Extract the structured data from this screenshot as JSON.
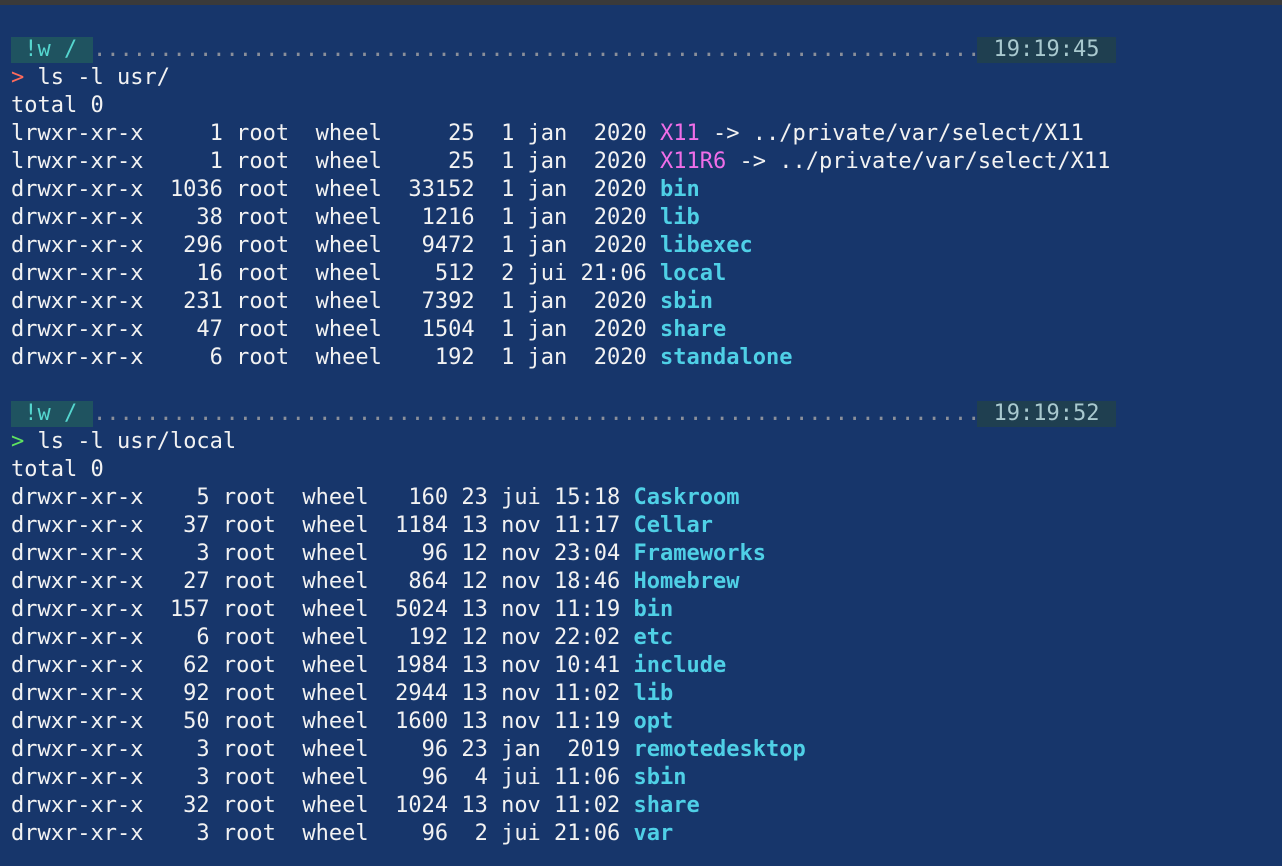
{
  "blocks": [
    {
      "path_segment": " !w / ",
      "dots": ".............................................................................................................",
      "time": "19:19:45",
      "prompt_symbol": ">",
      "command": " ls -l usr/",
      "total": "total 0",
      "rows": [
        {
          "meta": "lrwxr-xr-x     1 root  wheel     25  1 jan  2020 ",
          "name": "X11",
          "kind": "link",
          "target": " -> ../private/var/select/X11"
        },
        {
          "meta": "lrwxr-xr-x     1 root  wheel     25  1 jan  2020 ",
          "name": "X11R6",
          "kind": "link",
          "target": " -> ../private/var/select/X11"
        },
        {
          "meta": "drwxr-xr-x  1036 root  wheel  33152  1 jan  2020 ",
          "name": "bin",
          "kind": "dir",
          "target": ""
        },
        {
          "meta": "drwxr-xr-x    38 root  wheel   1216  1 jan  2020 ",
          "name": "lib",
          "kind": "dir",
          "target": ""
        },
        {
          "meta": "drwxr-xr-x   296 root  wheel   9472  1 jan  2020 ",
          "name": "libexec",
          "kind": "dir",
          "target": ""
        },
        {
          "meta": "drwxr-xr-x    16 root  wheel    512  2 jui 21:06 ",
          "name": "local",
          "kind": "dir",
          "target": ""
        },
        {
          "meta": "drwxr-xr-x   231 root  wheel   7392  1 jan  2020 ",
          "name": "sbin",
          "kind": "dir",
          "target": ""
        },
        {
          "meta": "drwxr-xr-x    47 root  wheel   1504  1 jan  2020 ",
          "name": "share",
          "kind": "dir",
          "target": ""
        },
        {
          "meta": "drwxr-xr-x     6 root  wheel    192  1 jan  2020 ",
          "name": "standalone",
          "kind": "dir",
          "target": ""
        }
      ]
    },
    {
      "path_segment": " !w / ",
      "dots": ".............................................................................................................",
      "time": "19:19:52",
      "prompt_symbol": ">",
      "command": " ls -l usr/local",
      "total": "total 0",
      "rows": [
        {
          "meta": "drwxr-xr-x    5 root  wheel   160 23 jui 15:18 ",
          "name": "Caskroom",
          "kind": "dir",
          "target": ""
        },
        {
          "meta": "drwxr-xr-x   37 root  wheel  1184 13 nov 11:17 ",
          "name": "Cellar",
          "kind": "dir",
          "target": ""
        },
        {
          "meta": "drwxr-xr-x    3 root  wheel    96 12 nov 23:04 ",
          "name": "Frameworks",
          "kind": "dir",
          "target": ""
        },
        {
          "meta": "drwxr-xr-x   27 root  wheel   864 12 nov 18:46 ",
          "name": "Homebrew",
          "kind": "dir",
          "target": ""
        },
        {
          "meta": "drwxr-xr-x  157 root  wheel  5024 13 nov 11:19 ",
          "name": "bin",
          "kind": "dir",
          "target": ""
        },
        {
          "meta": "drwxr-xr-x    6 root  wheel   192 12 nov 22:02 ",
          "name": "etc",
          "kind": "dir",
          "target": ""
        },
        {
          "meta": "drwxr-xr-x   62 root  wheel  1984 13 nov 10:41 ",
          "name": "include",
          "kind": "dir",
          "target": ""
        },
        {
          "meta": "drwxr-xr-x   92 root  wheel  2944 13 nov 11:02 ",
          "name": "lib",
          "kind": "dir",
          "target": ""
        },
        {
          "meta": "drwxr-xr-x   50 root  wheel  1600 13 nov 11:19 ",
          "name": "opt",
          "kind": "dir",
          "target": ""
        },
        {
          "meta": "drwxr-xr-x    3 root  wheel    96 23 jan  2019 ",
          "name": "remotedesktop",
          "kind": "dir",
          "target": ""
        },
        {
          "meta": "drwxr-xr-x    3 root  wheel    96  4 jui 11:06 ",
          "name": "sbin",
          "kind": "dir",
          "target": ""
        },
        {
          "meta": "drwxr-xr-x   32 root  wheel  1024 13 nov 11:02 ",
          "name": "share",
          "kind": "dir",
          "target": ""
        },
        {
          "meta": "drwxr-xr-x    3 root  wheel    96  2 jui 21:06 ",
          "name": "var",
          "kind": "dir",
          "target": ""
        }
      ]
    }
  ],
  "colors": {
    "background": "#17366b",
    "prompt_error": "#ff6b5b",
    "prompt_ok": "#5fe35f",
    "symlink": "#f06ee8",
    "directory": "#4fd0e6"
  }
}
